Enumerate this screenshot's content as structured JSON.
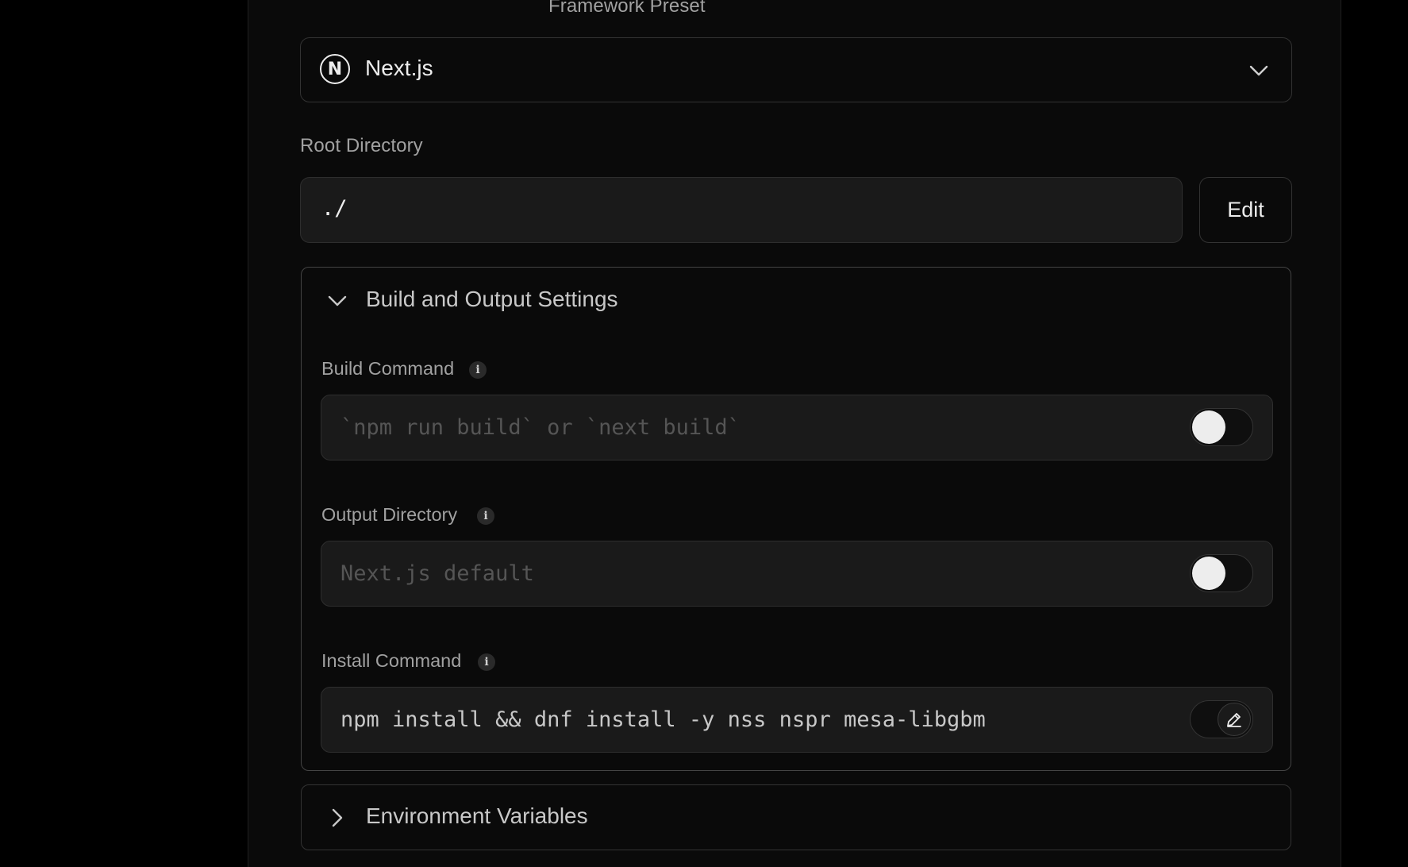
{
  "framework": {
    "label": "Framework Preset",
    "selected": "Next.js",
    "logo_letter": "N"
  },
  "root_directory": {
    "label": "Root Directory",
    "value": "./",
    "edit_label": "Edit"
  },
  "build_settings": {
    "title": "Build and Output Settings",
    "expanded": true,
    "fields": [
      {
        "label": "Build Command",
        "info_glyph": "i",
        "placeholder": "`npm run build` or `next build`",
        "override_enabled": false
      },
      {
        "label": "Output Directory",
        "info_glyph": "i",
        "placeholder": "Next.js default",
        "override_enabled": false
      },
      {
        "label": "Install Command",
        "info_glyph": "i",
        "value": "npm install && dnf install -y nss nspr mesa-libgbm",
        "override_enabled": true
      }
    ]
  },
  "env_section": {
    "title": "Environment Variables",
    "expanded": false
  },
  "colors": {
    "background": "#000000",
    "panel": "#0a0a0a",
    "input_bg": "#1a1a1a",
    "text_primary": "#ededed",
    "text_secondary": "#a1a1a1",
    "placeholder": "#555555"
  },
  "icons": [
    "nextjs-logo",
    "chevron-down-icon",
    "info-icon",
    "pencil-icon",
    "chevron-right-icon"
  ]
}
